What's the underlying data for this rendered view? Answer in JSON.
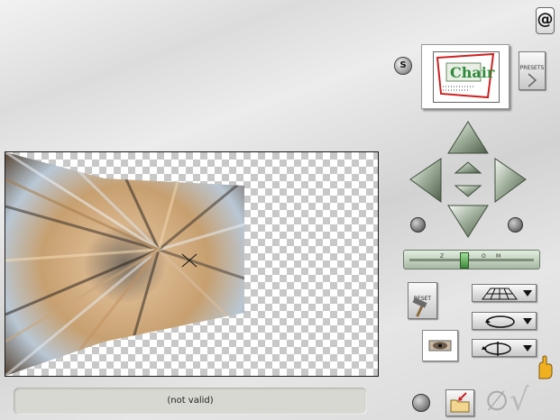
{
  "top_icon": {
    "glyph": "@"
  },
  "s_button": {
    "label": "S"
  },
  "thumbnail": {
    "brand_text": "Chair"
  },
  "presets_button": {
    "label": "PRESETS"
  },
  "reset_button": {
    "label": "RESET"
  },
  "slider": {
    "marks": [
      "Z",
      "O",
      "O",
      "M"
    ],
    "level_fraction": 0.43
  },
  "status": {
    "text": "(not valid)"
  },
  "null_glyph": "∅",
  "ok_glyph": "√",
  "colors": {
    "accent_red": "#cc2222",
    "accent_green": "#2d8a3a",
    "slider_thumb": "#4fa048"
  },
  "icons": {
    "top": "registered-at-icon",
    "s": "s-icon",
    "up": "arrow-up-icon",
    "down": "arrow-down-icon",
    "left": "arrow-left-icon",
    "right": "arrow-right-icon",
    "rotate_left": "rotate-left-icon",
    "rotate_right": "rotate-right-icon",
    "grid_perspective": "perspective-grid-icon",
    "rotate_loop": "rotate-loop-icon",
    "flip": "flip-icon",
    "hammer": "hammer-icon",
    "eye": "eye-thumbnail-icon",
    "grid": "grid-dots-icon",
    "folder": "folder-import-icon",
    "null": "none-icon",
    "ok": "check-icon",
    "hand": "pointing-hand-icon"
  }
}
